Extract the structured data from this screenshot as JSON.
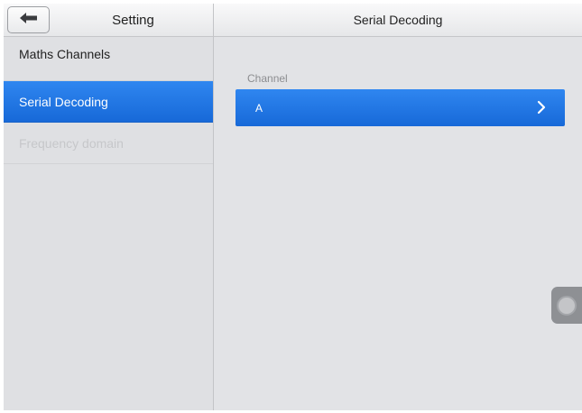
{
  "settings_header": {
    "back_icon": "arrow-left-icon",
    "title": "Setting"
  },
  "detail_header": {
    "title": "Serial Decoding"
  },
  "sidebar": {
    "items": [
      {
        "label": "Maths Channels",
        "state": "normal"
      },
      {
        "label": "Serial Decoding",
        "state": "selected"
      },
      {
        "label": "Frequency domain",
        "state": "disabled"
      }
    ]
  },
  "main": {
    "channel_label": "Channel",
    "channel_value": "A",
    "chevron_icon": "chevron-right-icon"
  },
  "colors": {
    "accent": "#1f76e4",
    "disabled_text": "#c6c7ca",
    "panel_bg": "#e2e3e6"
  }
}
